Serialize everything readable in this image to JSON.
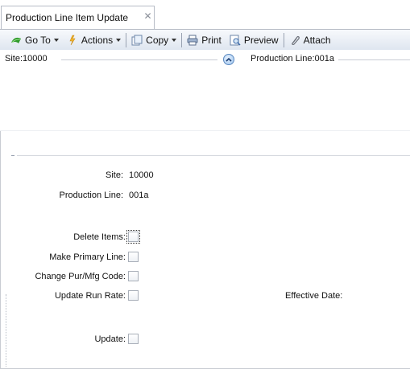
{
  "tab": {
    "title": "Production Line Item Update",
    "close_glyph": "✕"
  },
  "toolbar": {
    "goto": "Go To",
    "actions": "Actions",
    "copy": "Copy",
    "print": "Print",
    "preview": "Preview",
    "attach": "Attach"
  },
  "summary": {
    "site": "Site:10000",
    "production_line": "Production Line:001a"
  },
  "form": {
    "site_label": "Site:",
    "site_value": "10000",
    "production_line_label": "Production Line:",
    "production_line_value": "001a",
    "delete_items_label": "Delete Items:",
    "make_primary_line_label": "Make Primary Line:",
    "change_pur_mfg_code_label": "Change Pur/Mfg Code:",
    "update_run_rate_label": "Update Run Rate:",
    "effective_date_label": "Effective Date:",
    "update_label": "Update:"
  },
  "colors": {
    "toolbar_top": "#f7f9fc",
    "toolbar_bottom": "#dfe6f0",
    "collapse_button": "#9ec5ee"
  },
  "icons": [
    "go-to-icon",
    "actions-icon",
    "copy-icon",
    "print-icon",
    "preview-icon",
    "attach-icon",
    "collapse-icon",
    "close-icon"
  ]
}
